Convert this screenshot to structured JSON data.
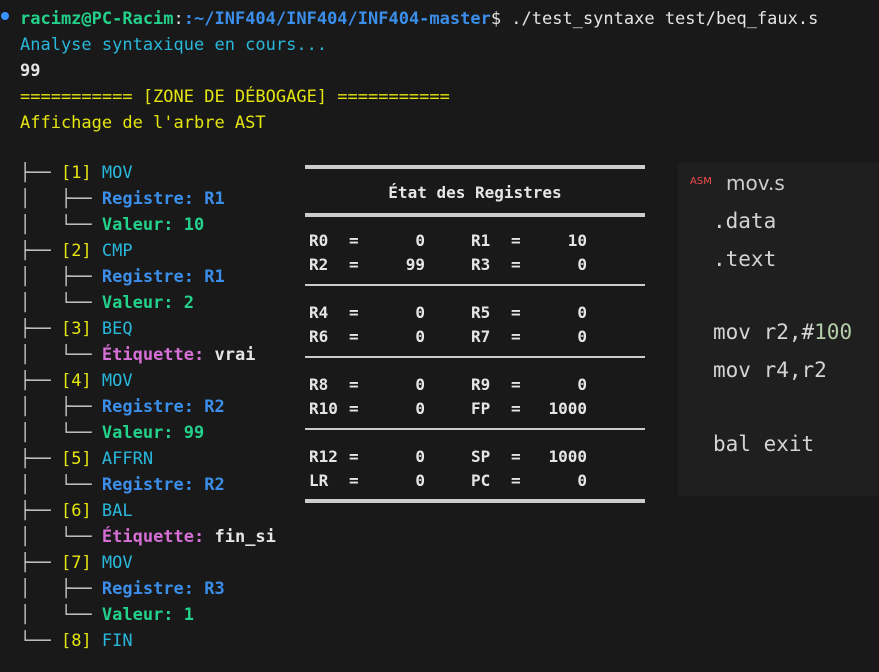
{
  "terminal": {
    "prompt_user": "racimz@PC-Racim",
    "prompt_path": ":~/INF404/INF404/INF404-master",
    "prompt_cmd": "$ ./test_syntaxe test/beq_faux.s",
    "line_analyse": "Analyse syntaxique en cours...",
    "line_99": "99",
    "debug_header": "=========== [ZONE DE DÉBOGAGE] ===========",
    "ast_title": "Affichage de l'arbre AST"
  },
  "tree": [
    {
      "idx": "[1]",
      "op": "MOV",
      "children": [
        {
          "k": "Registre: ",
          "v": "R1",
          "t": "reg"
        },
        {
          "k": "Valeur: ",
          "v": "10",
          "t": "val"
        }
      ]
    },
    {
      "idx": "[2]",
      "op": "CMP",
      "children": [
        {
          "k": "Registre: ",
          "v": "R1",
          "t": "reg"
        },
        {
          "k": "Valeur: ",
          "v": "2",
          "t": "val"
        }
      ]
    },
    {
      "idx": "[3]",
      "op": "BEQ",
      "children": [
        {
          "k": "Étiquette: ",
          "v": "vrai",
          "t": "lbl"
        }
      ]
    },
    {
      "idx": "[4]",
      "op": "MOV",
      "children": [
        {
          "k": "Registre: ",
          "v": "R2",
          "t": "reg"
        },
        {
          "k": "Valeur: ",
          "v": "99",
          "t": "val"
        }
      ]
    },
    {
      "idx": "[5]",
      "op": "AFFRN",
      "children": [
        {
          "k": "Registre: ",
          "v": "R2",
          "t": "reg"
        }
      ]
    },
    {
      "idx": "[6]",
      "op": "BAL",
      "children": [
        {
          "k": "Étiquette: ",
          "v": "fin_si",
          "t": "lbl"
        }
      ]
    },
    {
      "idx": "[7]",
      "op": "MOV",
      "children": [
        {
          "k": "Registre: ",
          "v": "R3",
          "t": "reg"
        },
        {
          "k": "Valeur: ",
          "v": "1",
          "t": "val"
        }
      ]
    },
    {
      "idx": "[8]",
      "op": "FIN",
      "children": []
    }
  ],
  "registers": {
    "title": "État des Registres",
    "groups": [
      [
        [
          [
            "R0",
            "0"
          ],
          [
            "R1",
            "10"
          ]
        ],
        [
          [
            "R2",
            "99"
          ],
          [
            "R3",
            "0"
          ]
        ]
      ],
      [
        [
          [
            "R4",
            "0"
          ],
          [
            "R5",
            "0"
          ]
        ],
        [
          [
            "R6",
            "0"
          ],
          [
            "R7",
            "0"
          ]
        ]
      ],
      [
        [
          [
            "R8",
            "0"
          ],
          [
            "R9",
            "0"
          ]
        ],
        [
          [
            "R10",
            "0"
          ],
          [
            "FP",
            "1000"
          ]
        ]
      ],
      [
        [
          [
            "R12",
            "0"
          ],
          [
            "SP",
            "1000"
          ]
        ],
        [
          [
            "LR",
            "0"
          ],
          [
            "PC",
            "0"
          ]
        ]
      ]
    ]
  },
  "editor": {
    "badge": "ASM",
    "file": "mov.s",
    "lines": [
      ".data",
      ".text",
      "",
      "mov r2,#100",
      "mov r4,r2",
      "",
      "bal exit"
    ]
  }
}
